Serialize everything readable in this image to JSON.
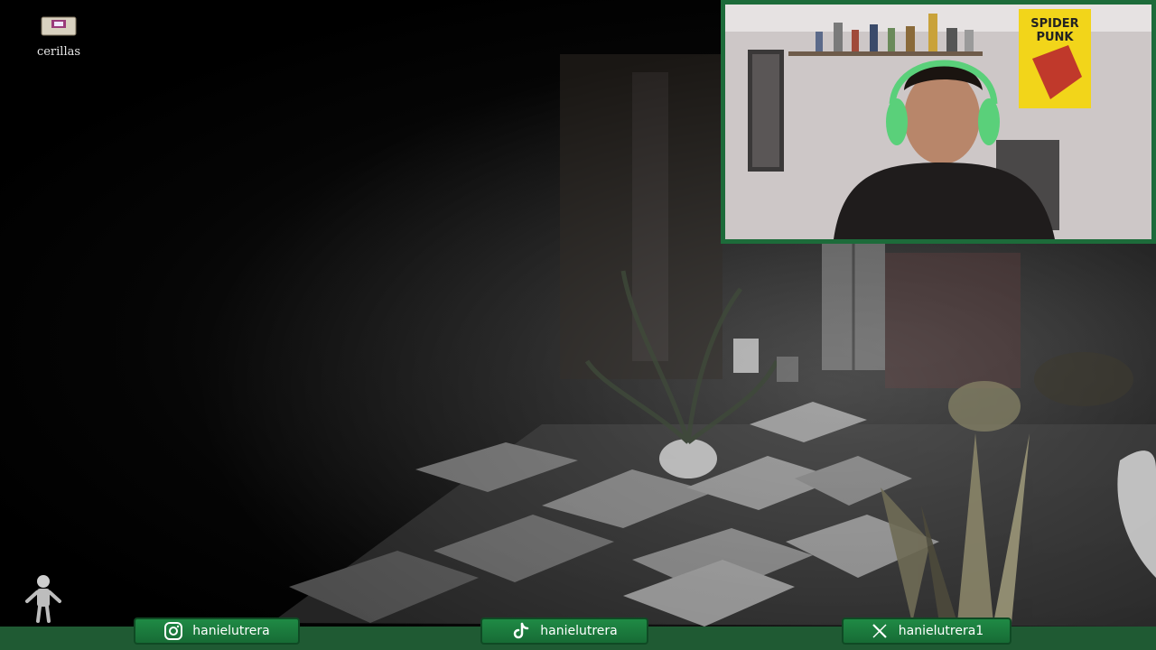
{
  "hud": {
    "inventory_item": {
      "name": "cerillas",
      "icon": "matchbox-icon"
    },
    "player_icon": "player-figure-icon"
  },
  "webcam": {
    "poster_text": [
      "SPIDER",
      "PUNK"
    ]
  },
  "social": [
    {
      "platform": "instagram",
      "icon": "instagram-icon",
      "handle": "hanielutrera"
    },
    {
      "platform": "tiktok",
      "icon": "tiktok-icon",
      "handle": "hanielutrera"
    },
    {
      "platform": "x",
      "icon": "x-icon",
      "handle": "hanielutrera1"
    }
  ],
  "colors": {
    "bar_green": "#1f5a33",
    "pill_green": "#1f8a45",
    "webcam_border": "#1d6b3a"
  }
}
